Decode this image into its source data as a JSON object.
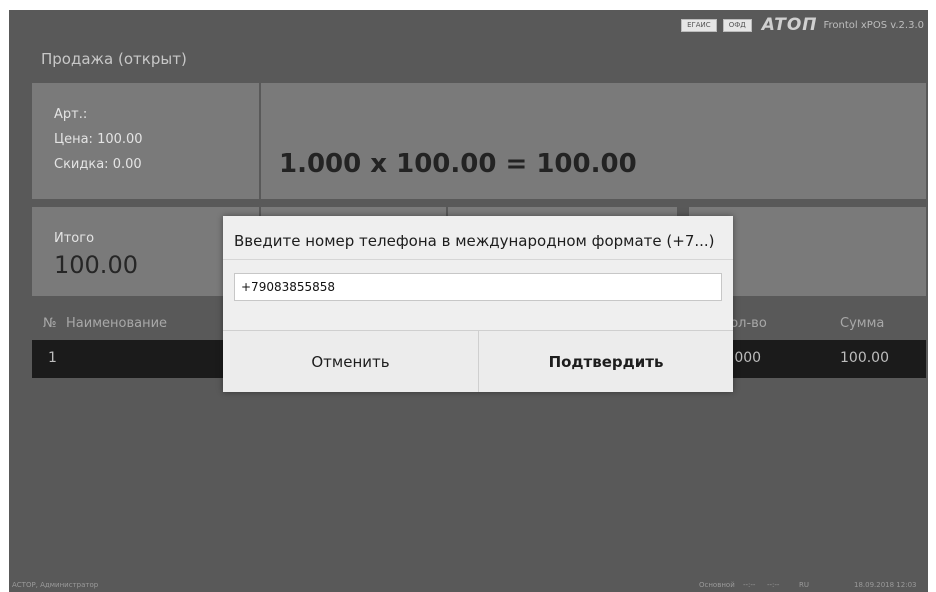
{
  "header": {
    "badges": [
      "ЕГАИС",
      "ОФД"
    ],
    "logo": "ATOΠ",
    "version": "Frontol xPOS v.2.3.0",
    "title": "Продажа (открыт)"
  },
  "item_info": {
    "article": "Арт.:",
    "price": "Цена:  100.00",
    "discount": "Скидка:   0.00",
    "formula": "1.000 x 100.00 = 100.00"
  },
  "total": {
    "label": "Итого",
    "value": "100.00"
  },
  "table": {
    "columns": {
      "num": "№",
      "name": "Наименование",
      "qty": "Кол-во",
      "sum": "Сумма"
    },
    "rows": [
      {
        "num": "1",
        "qty": "1.000",
        "sum": "100.00"
      }
    ]
  },
  "status": {
    "user": "АСТОР, Администратор",
    "mode": "Основной",
    "ind1": "--:--",
    "ind2": "--:--",
    "lang": "RU",
    "datetime": "18.09.2018 12:03"
  },
  "dialog": {
    "title": "Введите номер телефона в международном формате (+7...)",
    "phone_value": "+79083855858",
    "cancel_label": "Отменить",
    "confirm_label": "Подтвердить"
  }
}
